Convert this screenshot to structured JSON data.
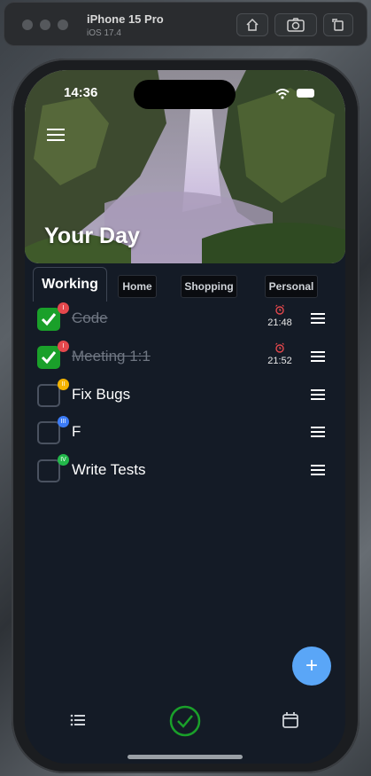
{
  "simulator": {
    "device_name": "iPhone 15 Pro",
    "os_version": "iOS 17.4"
  },
  "status_bar": {
    "time": "14:36"
  },
  "hero": {
    "title": "Your Day"
  },
  "tabs": [
    {
      "label": "Working",
      "active": true
    },
    {
      "label": "Home",
      "active": false
    },
    {
      "label": "Shopping",
      "active": false
    },
    {
      "label": "Personal",
      "active": false
    }
  ],
  "tasks": [
    {
      "title": "Code",
      "done": true,
      "badge": "I",
      "badge_color": "#e5484d",
      "alarm_time": "21:48"
    },
    {
      "title": "Meeting 1:1",
      "done": true,
      "badge": "I",
      "badge_color": "#e5484d",
      "alarm_time": "21:52"
    },
    {
      "title": "Fix Bugs",
      "done": false,
      "badge": "II",
      "badge_color": "#f5b400"
    },
    {
      "title": "F",
      "done": false,
      "badge": "III",
      "badge_color": "#3b7bf6"
    },
    {
      "title": "Write Tests",
      "done": false,
      "badge": "IV",
      "badge_color": "#22b84a"
    }
  ],
  "colors": {
    "background": "#141b26",
    "checked": "#1aa02a",
    "fab": "#5aa6f7",
    "alarm_icon": "#e5484d",
    "active_tab_icon": "#1aa02a"
  },
  "bottom_bar": {
    "items": [
      {
        "icon": "list-icon"
      },
      {
        "icon": "checkmark-circle-icon"
      },
      {
        "icon": "calendar-icon"
      }
    ]
  },
  "fab": {
    "label": "+"
  }
}
